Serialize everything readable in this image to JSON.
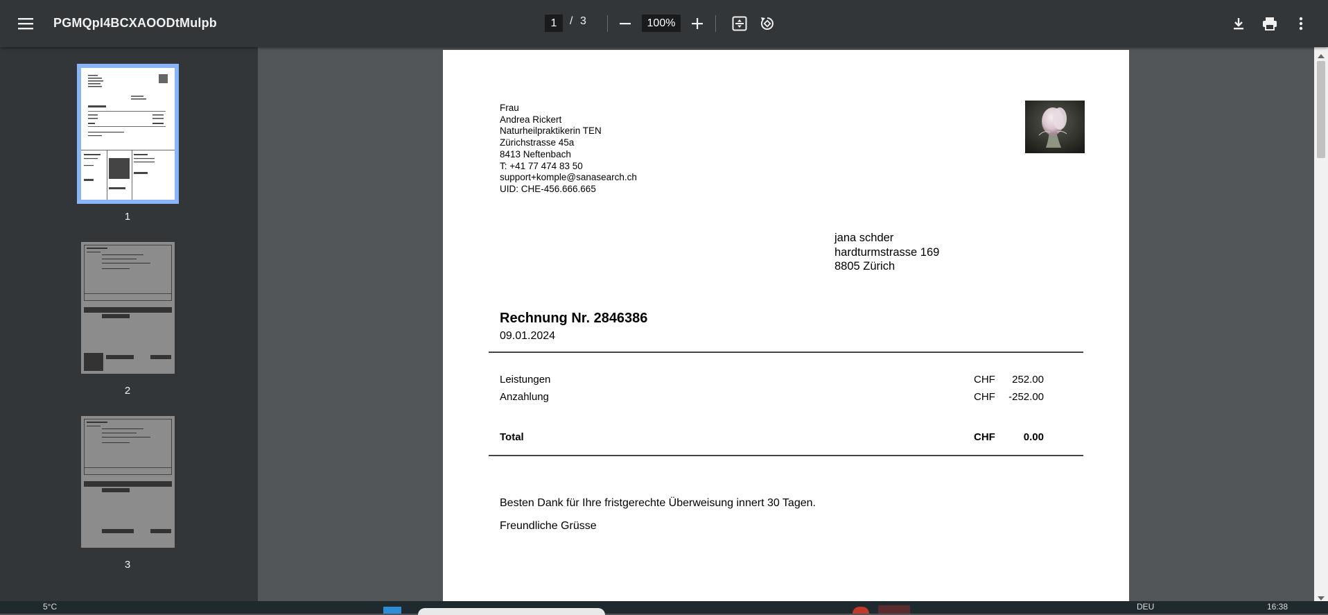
{
  "toolbar": {
    "title": "PGMQpI4BCXAOODtMulpb",
    "page_current": "1",
    "page_separator": "/",
    "page_total": "3",
    "zoom": "100%",
    "icons": [
      "menu-icon",
      "zoom-out-icon",
      "zoom-in-icon",
      "fit-page-icon",
      "rotate-icon",
      "download-icon",
      "print-icon",
      "more-icon"
    ]
  },
  "sidebar": {
    "thumbnails": [
      {
        "label": "1",
        "selected": true
      },
      {
        "label": "2",
        "selected": false
      },
      {
        "label": "3",
        "selected": false
      }
    ]
  },
  "document": {
    "sender": {
      "salutation": "Frau",
      "name": "Andrea Rickert",
      "title": "Naturheilpraktikerin TEN",
      "street": "Zürichstrasse 45a",
      "city": "8413 Neftenbach",
      "phone": "T: +41 77 474 83 50",
      "email": "support+komple@sanasearch.ch",
      "uid": "UID: CHE-456.666.665"
    },
    "recipient": {
      "name": "jana schder",
      "street": "hardturmstrasse 169",
      "city": "8805 Zürich"
    },
    "invoice_title": "Rechnung Nr. 2846386",
    "invoice_date": "09.01.2024",
    "lines": [
      {
        "label": "Leistungen",
        "currency": "CHF",
        "amount": "252.00"
      },
      {
        "label": "Anzahlung",
        "currency": "CHF",
        "amount": "-252.00"
      }
    ],
    "total": {
      "label": "Total",
      "currency": "CHF",
      "amount": "0.00"
    },
    "thanks": "Besten Dank für Ihre fristgerechte Überweisung innert 30 Tagen.",
    "closing": "Freundliche Grüsse"
  },
  "taskbar": {
    "weather": "5°C",
    "lang": "DEU",
    "time": "16:38"
  }
}
